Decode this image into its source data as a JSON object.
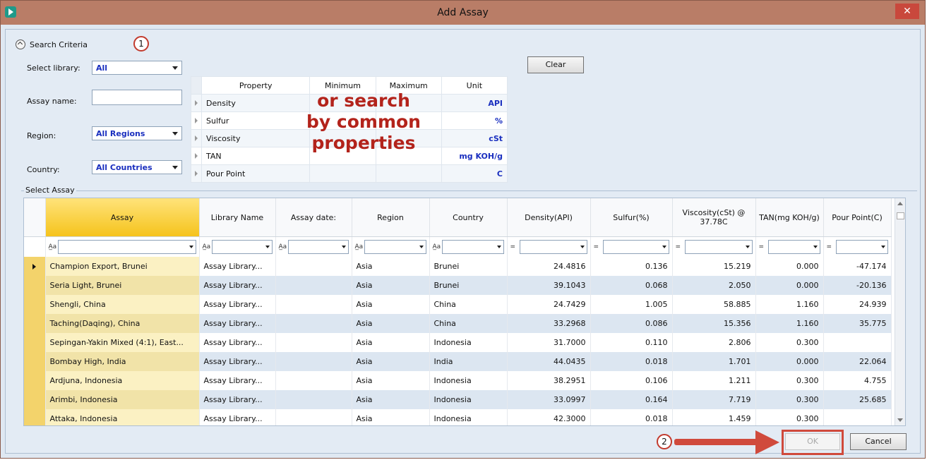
{
  "window": {
    "title": "Add Assay",
    "close_label": "✕"
  },
  "search": {
    "section_label": "Search Criteria",
    "callout1": "1",
    "library_label": "Select library:",
    "library_value": "All",
    "assay_name_label": "Assay name:",
    "assay_name_value": "",
    "region_label": "Region:",
    "region_value": "All Regions",
    "country_label": "Country:",
    "country_value": "All Countries",
    "clear_label": "Clear",
    "property_table": {
      "headers": [
        "Property",
        "Minimum",
        "Maximum",
        "Unit"
      ],
      "rows": [
        {
          "property": "Density",
          "unit": "API"
        },
        {
          "property": "Sulfur",
          "unit": "%"
        },
        {
          "property": "Viscosity",
          "unit": "cSt"
        },
        {
          "property": "TAN",
          "unit": "mg KOH/g"
        },
        {
          "property": "Pour Point",
          "unit": "C"
        }
      ]
    },
    "overlay_text": "or search by common properties"
  },
  "assay_grid": {
    "group_label": "Select Assay",
    "columns": [
      "Assay",
      "Library Name",
      "Assay date:",
      "Region",
      "Country",
      "Density(API)",
      "Sulfur(%)",
      "Viscosity(cSt) @ 37.78C",
      "TAN(mg KOH/g)",
      "Pour Point(C)"
    ],
    "filter_ops": [
      "A̲a",
      "A̲a",
      "A̲a",
      "A̲a",
      "A̲a",
      "=",
      "=",
      "=",
      "=",
      "="
    ],
    "rows": [
      [
        "Champion Export, Brunei",
        "Assay Library...",
        "",
        "Asia",
        "Brunei",
        "24.4816",
        "0.136",
        "15.219",
        "0.000",
        "-47.174"
      ],
      [
        "Seria Light, Brunei",
        "Assay Library...",
        "",
        "Asia",
        "Brunei",
        "39.1043",
        "0.068",
        "2.050",
        "0.000",
        "-20.136"
      ],
      [
        "Shengli, China",
        "Assay Library...",
        "",
        "Asia",
        "China",
        "24.7429",
        "1.005",
        "58.885",
        "1.160",
        "24.939"
      ],
      [
        "Taching(Daqing), China",
        "Assay Library...",
        "",
        "Asia",
        "China",
        "33.2968",
        "0.086",
        "15.356",
        "1.160",
        "35.775"
      ],
      [
        "Sepingan-Yakin Mixed (4:1), East...",
        "Assay Library...",
        "",
        "Asia",
        "Indonesia",
        "31.7000",
        "0.110",
        "2.806",
        "0.300",
        ""
      ],
      [
        "Bombay High, India",
        "Assay Library...",
        "",
        "Asia",
        "India",
        "44.0435",
        "0.018",
        "1.701",
        "0.000",
        "22.064"
      ],
      [
        "Ardjuna, Indonesia",
        "Assay Library...",
        "",
        "Asia",
        "Indonesia",
        "38.2951",
        "0.106",
        "1.211",
        "0.300",
        "4.755"
      ],
      [
        "Arimbi, Indonesia",
        "Assay Library...",
        "",
        "Asia",
        "Indonesia",
        "33.0997",
        "0.164",
        "7.719",
        "0.300",
        "25.685"
      ],
      [
        "Attaka, Indonesia",
        "Assay Library...",
        "",
        "Asia",
        "Indonesia",
        "42.3000",
        "0.018",
        "1.459",
        "0.300",
        ""
      ]
    ]
  },
  "footer": {
    "callout2": "2",
    "ok_label": "OK",
    "cancel_label": "Cancel"
  }
}
